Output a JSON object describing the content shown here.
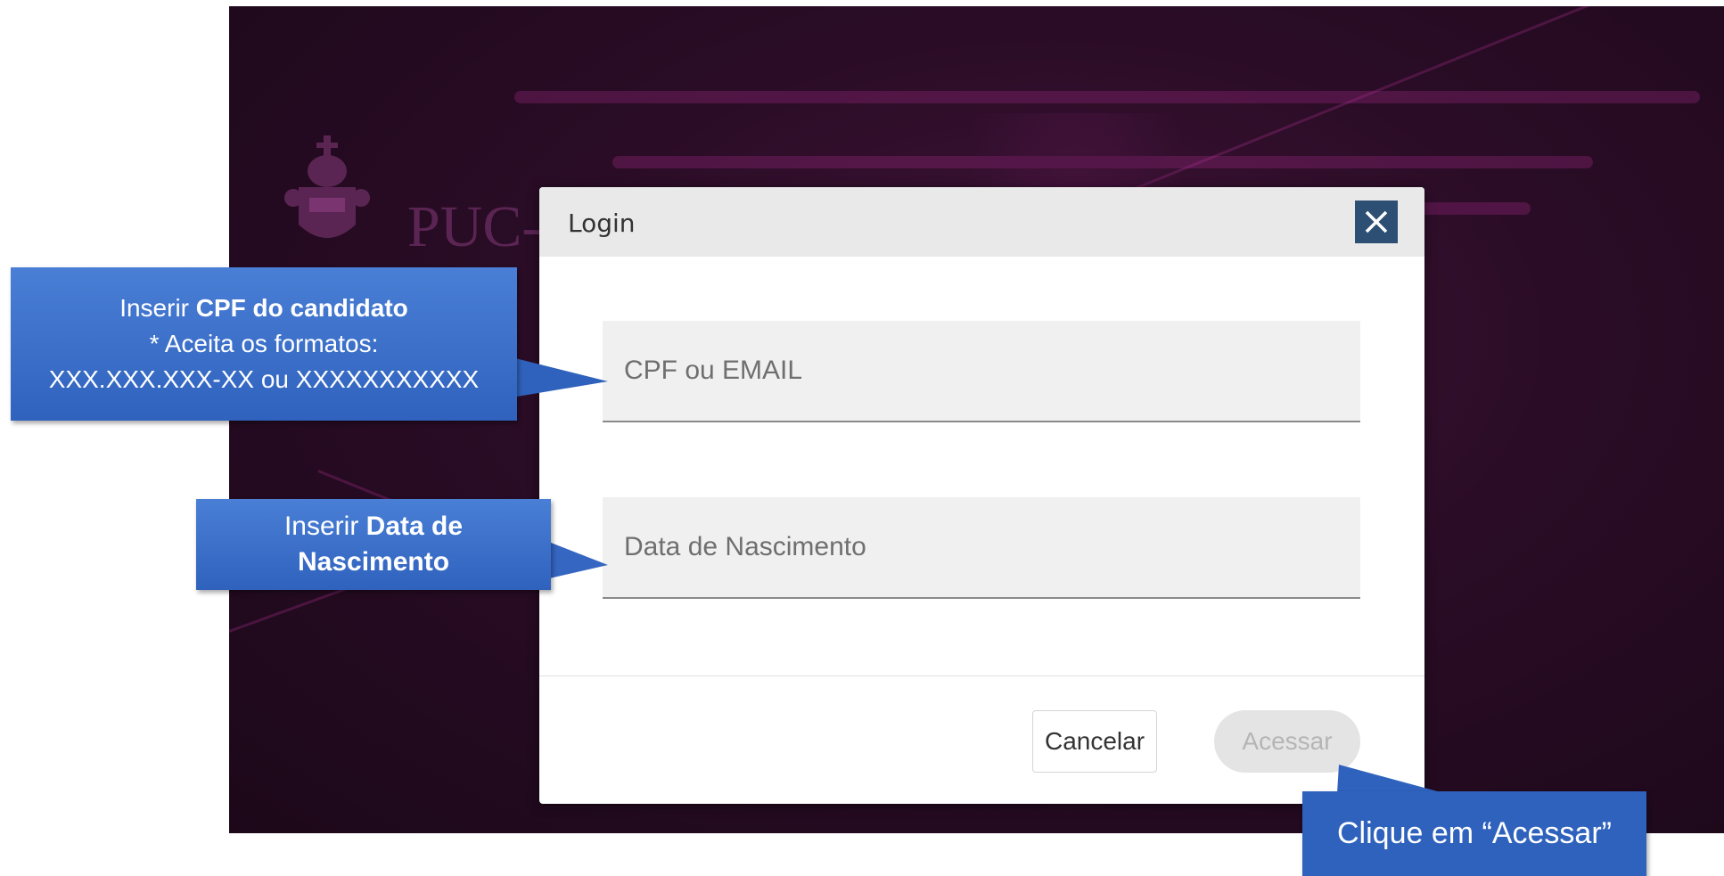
{
  "background": {
    "brand_text": "PUC-"
  },
  "modal": {
    "title": "Login",
    "close_label": "×",
    "fields": {
      "cpf_placeholder": "CPF ou EMAIL",
      "birth_placeholder": "Data de Nascimento"
    },
    "buttons": {
      "cancel": "Cancelar",
      "access": "Acessar"
    }
  },
  "callouts": {
    "cpf": {
      "line1_prefix": "Inserir ",
      "line1_bold": "CPF do candidato",
      "line2": "* Aceita os formatos:",
      "line3": "XXX.XXX.XXX-XX ou XXXXXXXXXXX"
    },
    "birth": {
      "line1_prefix": "Inserir ",
      "line1_bold": "Data de",
      "line2_bold": "Nascimento"
    },
    "access": {
      "text": "Clique em “Acessar”"
    }
  },
  "colors": {
    "callout_blue": "#2f62bd",
    "close_button": "#2d4f73",
    "background_purple": "#2a0c26"
  }
}
